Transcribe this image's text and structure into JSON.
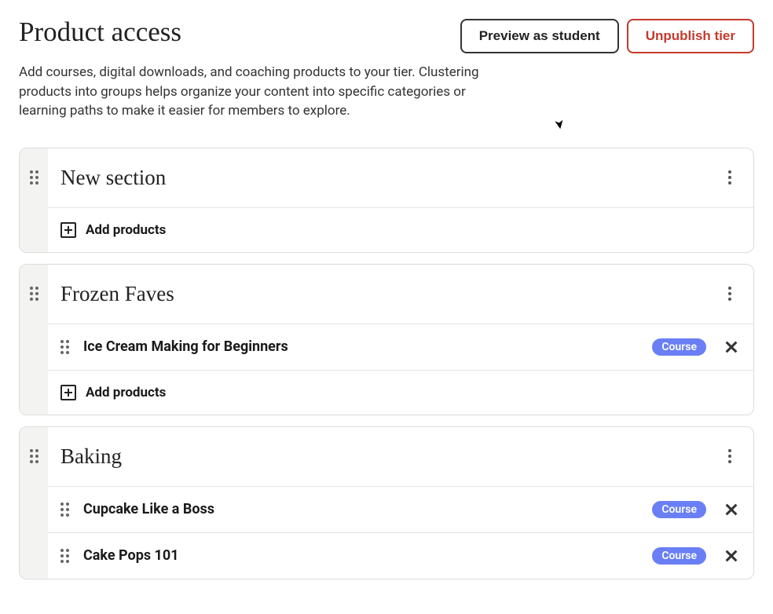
{
  "header": {
    "title": "Product access",
    "preview_label": "Preview as student",
    "unpublish_label": "Unpublish tier"
  },
  "description": "Add courses, digital downloads, and coaching products to your tier. Clustering products into groups helps organize your content into specific categories or learning paths to make it easier for members to explore.",
  "add_products_label": "Add products",
  "badge_course": "Course",
  "sections": [
    {
      "title": "New section",
      "products": []
    },
    {
      "title": "Frozen Faves",
      "products": [
        {
          "title": "Ice Cream Making for Beginners",
          "type": "Course"
        }
      ]
    },
    {
      "title": "Baking",
      "products": [
        {
          "title": "Cupcake Like a Boss",
          "type": "Course"
        },
        {
          "title": "Cake Pops 101",
          "type": "Course"
        }
      ]
    }
  ]
}
